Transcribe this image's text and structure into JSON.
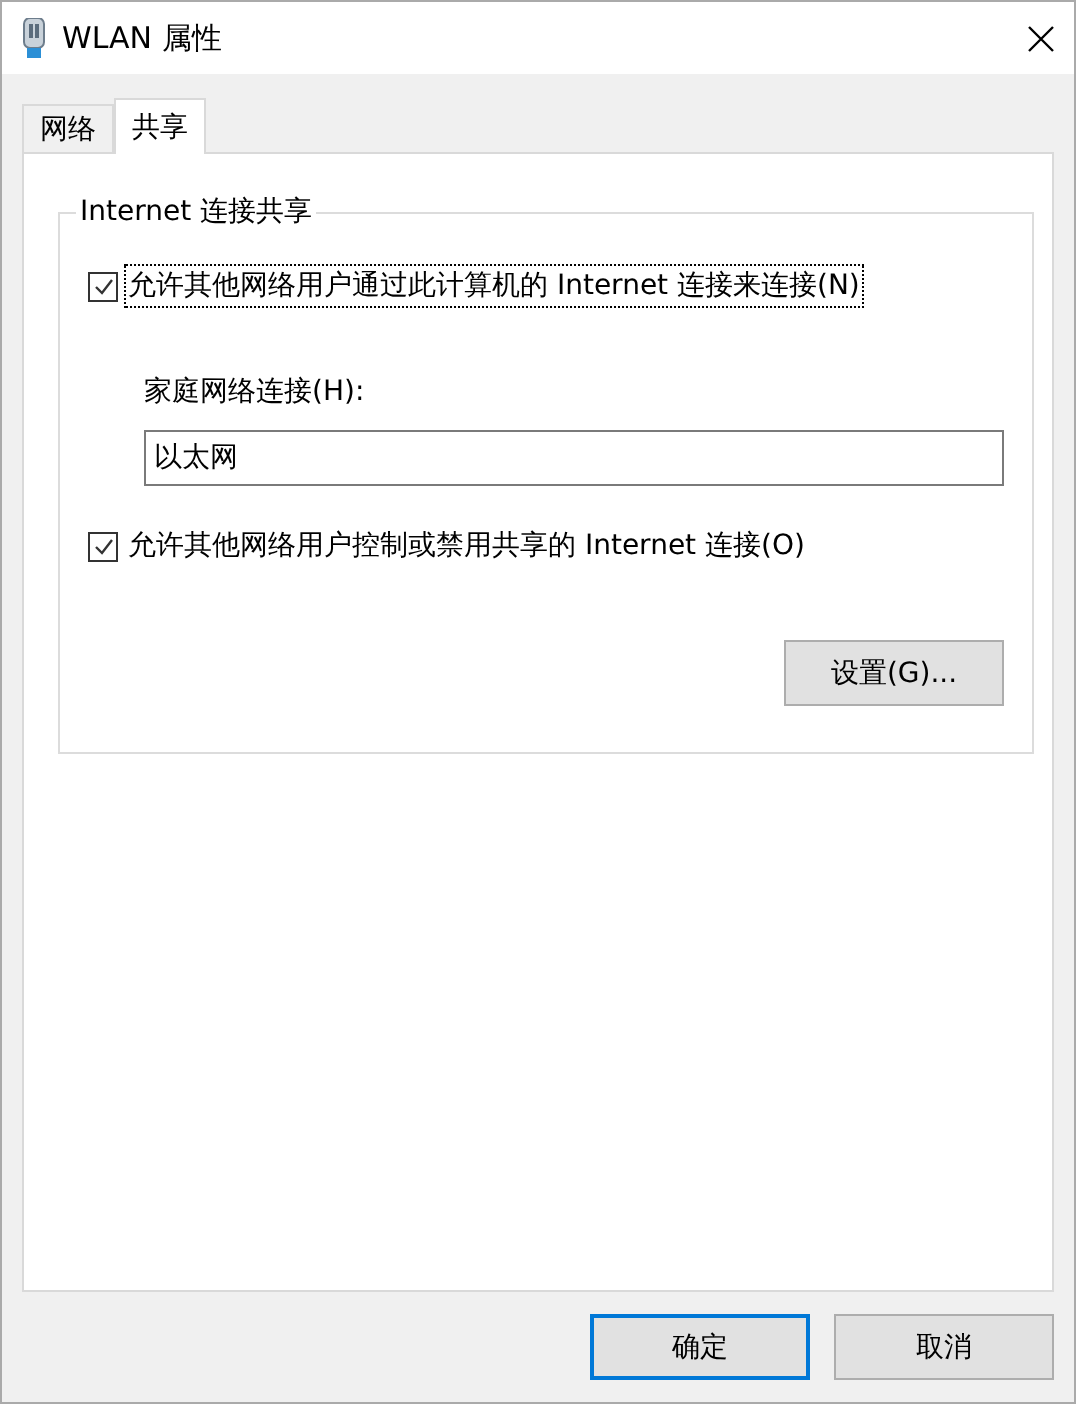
{
  "window": {
    "title": "WLAN 属性"
  },
  "tabs": [
    {
      "label": "网络",
      "selected": false
    },
    {
      "label": "共享",
      "selected": true
    }
  ],
  "group": {
    "title": "Internet 连接共享",
    "options": [
      {
        "label": "允许其他网络用户通过此计算机的 Internet 连接来连接(N)",
        "checked": true,
        "focused": true
      },
      {
        "label": "允许其他网络用户控制或禁用共享的 Internet 连接(O)",
        "checked": true,
        "focused": false
      }
    ],
    "home_connection": {
      "label": "家庭网络连接(H):",
      "value": "以太网"
    },
    "settings_button": "设置(G)..."
  },
  "buttons": [
    {
      "label": "确定",
      "default": true
    },
    {
      "label": "取消",
      "default": false
    }
  ]
}
